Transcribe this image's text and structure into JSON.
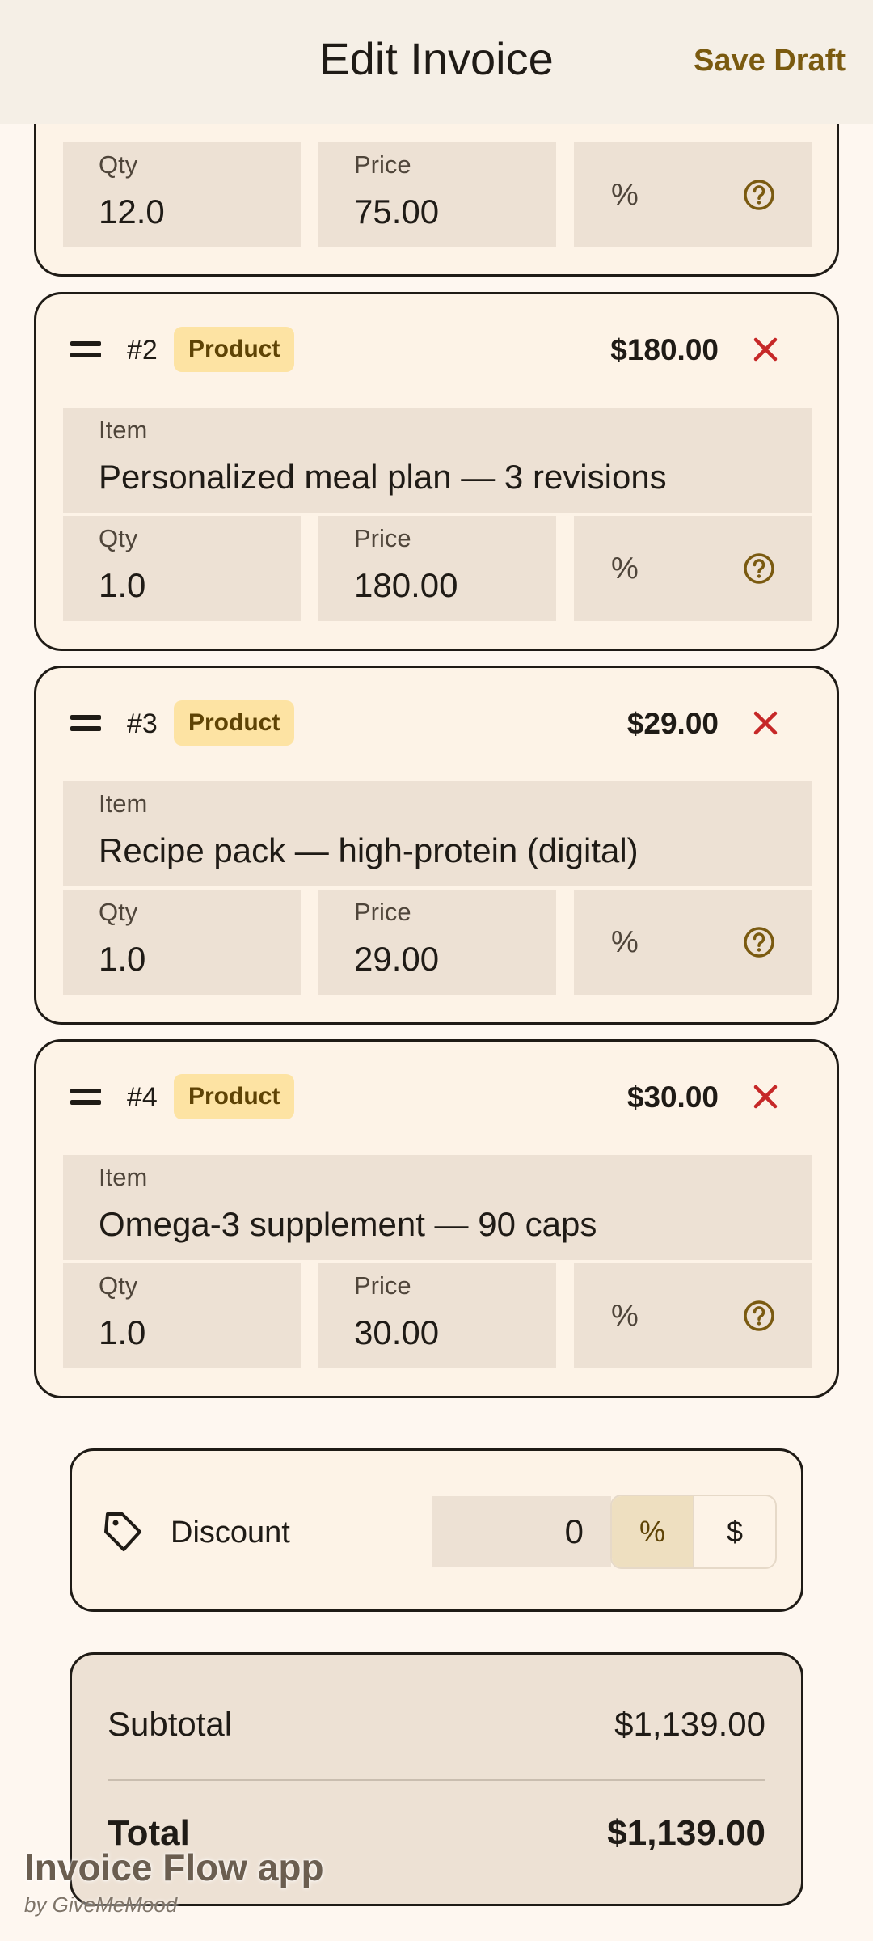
{
  "app_bar": {
    "title": "Edit Invoice",
    "save_label": "Save Draft"
  },
  "field_labels": {
    "item": "Item",
    "qty": "Qty",
    "price": "Price",
    "percent": "%"
  },
  "items": [
    {
      "qty": "12.0",
      "price": "75.00"
    },
    {
      "number": "#2",
      "type": "Product",
      "amount": "$180.00",
      "item": "Personalized meal plan — 3 revisions",
      "qty": "1.0",
      "price": "180.00"
    },
    {
      "number": "#3",
      "type": "Product",
      "amount": "$29.00",
      "item": "Recipe pack — high-protein (digital)",
      "qty": "1.0",
      "price": "29.00"
    },
    {
      "number": "#4",
      "type": "Product",
      "amount": "$30.00",
      "item": "Omega-3 supplement — 90 caps",
      "qty": "1.0",
      "price": "30.00"
    }
  ],
  "discount": {
    "label": "Discount",
    "value": "0",
    "options": [
      "%",
      "$"
    ],
    "selected": "%"
  },
  "totals": {
    "subtotal_label": "Subtotal",
    "subtotal_value": "$1,139.00",
    "total_label": "Total",
    "total_value": "$1,139.00"
  },
  "watermark": {
    "title": "Invoice Flow app",
    "subtitle": "by GiveMeMood"
  },
  "colors": {
    "accent": "#7A5A10",
    "danger": "#C62828",
    "tag_bg": "#FDE3A3",
    "card_bg": "#FDF3E7",
    "field_bg": "#EDE1D4"
  }
}
